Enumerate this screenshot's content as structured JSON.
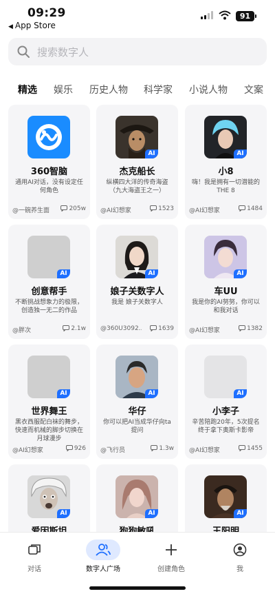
{
  "status_bar": {
    "time": "09:29",
    "back_app": "App Store",
    "battery": "91"
  },
  "search": {
    "placeholder": "搜索数字人"
  },
  "tabs": [
    {
      "label": "精选",
      "active": true
    },
    {
      "label": "娱乐",
      "active": false
    },
    {
      "label": "历史人物",
      "active": false
    },
    {
      "label": "科学家",
      "active": false
    },
    {
      "label": "小说人物",
      "active": false
    },
    {
      "label": "文案",
      "active": false
    }
  ],
  "cards": [
    {
      "name": "360智脑",
      "desc": "通用AI对话，没有设定任何角色",
      "author": "@一碗养生面",
      "count": "205w",
      "icon": "360-logo-icon",
      "ai_badge": false
    },
    {
      "name": "杰克船长",
      "desc": "纵横四大洋的传奇海盗（九大海盗王之一）",
      "author": "@AI幻想家",
      "count": "1523",
      "icon": "pirate-portrait-icon",
      "ai_badge": true
    },
    {
      "name": "小8",
      "desc": "嗨！我是拥有一切潜能的THE 8",
      "author": "@AI幻想家",
      "count": "1484",
      "icon": "blue-hair-portrait-icon",
      "ai_badge": true
    },
    {
      "name": "创意帮手",
      "desc": "不断挑战想象力的极限，创造独一无二的作品",
      "author": "@胖次",
      "count": "2.1w",
      "icon": "placeholder-avatar-icon",
      "ai_badge": true
    },
    {
      "name": "娘子关数字人",
      "desc": "我是 娘子关数字人",
      "author": "@360U3092...",
      "count": "1639",
      "icon": "woman-portrait-icon",
      "ai_badge": true
    },
    {
      "name": "车UU",
      "desc": "我是你的AI努努，你可以和我对话",
      "author": "@AI幻想家",
      "count": "1382",
      "icon": "young-man-portrait-icon",
      "ai_badge": true
    },
    {
      "name": "世界舞王",
      "desc": "黑衣西服配白袜的舞步，快速而机械的脚步切换在月球漫步",
      "author": "@AI幻想家",
      "count": "926",
      "icon": "placeholder-avatar-icon",
      "ai_badge": true
    },
    {
      "name": "华仔",
      "desc": "你可以把AI当成华仔向ta提问",
      "author": "@飞行员",
      "count": "1.3w",
      "icon": "man-illustration-icon",
      "ai_badge": true
    },
    {
      "name": "小李子",
      "desc": "辛苦陪跑20年，5次提名终于拿下奥斯卡影帝",
      "author": "@AI幻想家",
      "count": "1455",
      "icon": "placeholder-avatar-icon",
      "ai_badge": true
    },
    {
      "name": "爱因斯坦",
      "desc": "",
      "author": "",
      "count": "",
      "icon": "einstein-portrait-icon",
      "ai_badge": true
    },
    {
      "name": "狗狗敏吼",
      "desc": "",
      "author": "",
      "count": "",
      "icon": "girl-portrait-icon",
      "ai_badge": true
    },
    {
      "name": "王阳明",
      "desc": "",
      "author": "",
      "count": "",
      "icon": "old-man-portrait-icon",
      "ai_badge": true
    }
  ],
  "bottom_nav": [
    {
      "label": "对话",
      "icon": "chat-icon",
      "active": false
    },
    {
      "label": "数字人广场",
      "icon": "people-icon",
      "active": true
    },
    {
      "label": "创建角色",
      "icon": "plus-icon",
      "active": false
    },
    {
      "label": "我",
      "icon": "profile-icon",
      "active": false
    }
  ],
  "colors": {
    "accent": "#1e6fff",
    "card_bg": "#f5f5f7",
    "active_nav_bg": "#dfe9ff"
  }
}
